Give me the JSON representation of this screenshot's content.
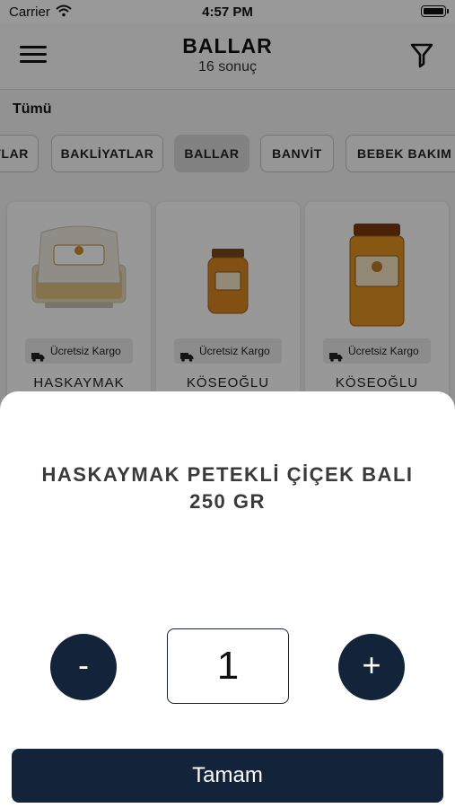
{
  "status_bar": {
    "carrier": "Carrier",
    "time": "4:57 PM"
  },
  "header": {
    "title": "BALLAR",
    "subtitle": "16 sonuç"
  },
  "section_label": "Tümü",
  "categories": [
    {
      "label": "TLAR",
      "active": false
    },
    {
      "label": "BAKLİYATLAR",
      "active": false
    },
    {
      "label": "BALLAR",
      "active": true
    },
    {
      "label": "BANVİT",
      "active": false
    },
    {
      "label": "BEBEK BAKIM Ü",
      "active": false
    }
  ],
  "products": [
    {
      "badge": "Ücretsiz Kargo",
      "brand": "HASKAYMAK"
    },
    {
      "badge": "Ücretsiz Kargo",
      "brand": "KÖSEOĞLU"
    },
    {
      "badge": "Ücretsiz Kargo",
      "brand": "KÖSEOĞLU"
    }
  ],
  "sheet": {
    "product_name_line1": "HASKAYMAK PETEKLİ ÇİÇEK BALI",
    "product_name_line2": "250 GR",
    "minus_label": "-",
    "plus_label": "+",
    "quantity": "1",
    "confirm_label": "Tamam"
  },
  "colors": {
    "primary": "#13243a",
    "overlay": "rgba(0,0,0,0.40)"
  }
}
